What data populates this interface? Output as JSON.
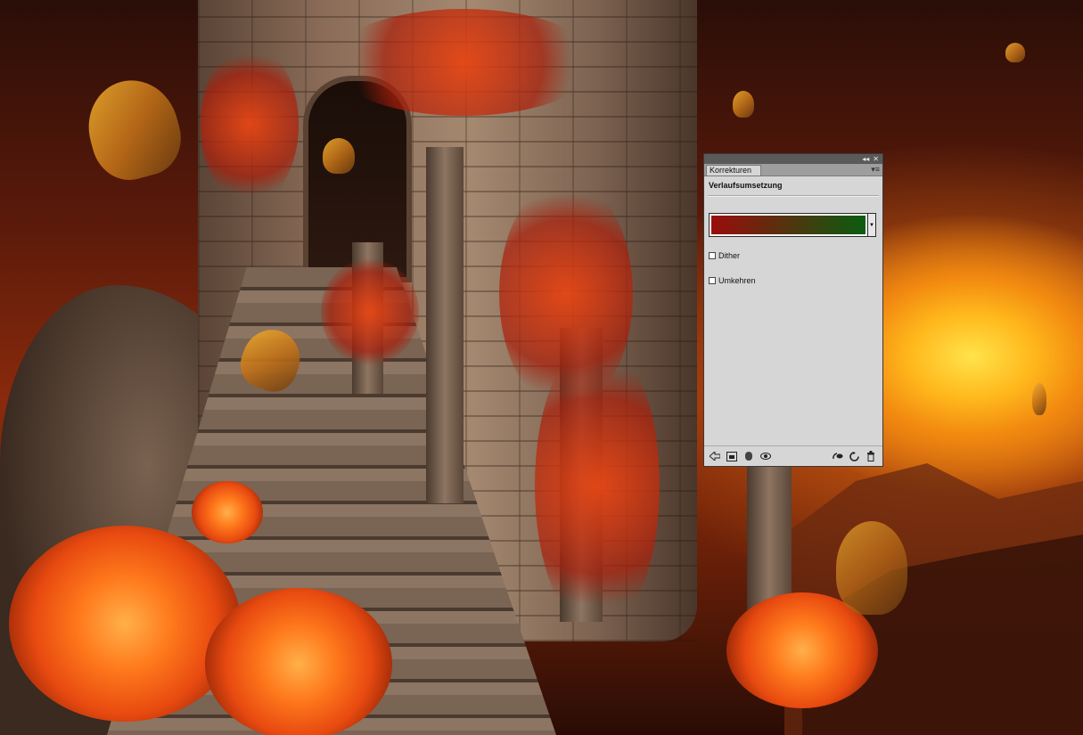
{
  "panel": {
    "tab_label": "Korrekturen",
    "title": "Verlaufsumsetzung",
    "collapse_icon": "◂◂",
    "close_icon": "✕",
    "menu_icon": "▾≡",
    "gradient": {
      "start_color": "#9a0d0d",
      "end_color": "#0a5c10",
      "dropdown_icon": "▼"
    },
    "options": [
      {
        "label": "Dither",
        "checked": false
      },
      {
        "label": "Umkehren",
        "checked": false
      }
    ],
    "toolbar_icons": [
      "back-arrow-icon",
      "clip-to-layer-icon",
      "layer-visibility-mask-icon",
      "eye-icon",
      "view-previous-state-icon",
      "reset-icon",
      "delete-icon"
    ]
  },
  "canvas": {
    "description_colors": {
      "sky": "#8a2a0c",
      "sun": "#ffd23a",
      "stone": "#8e7562",
      "ivy": "#e0461a"
    }
  }
}
